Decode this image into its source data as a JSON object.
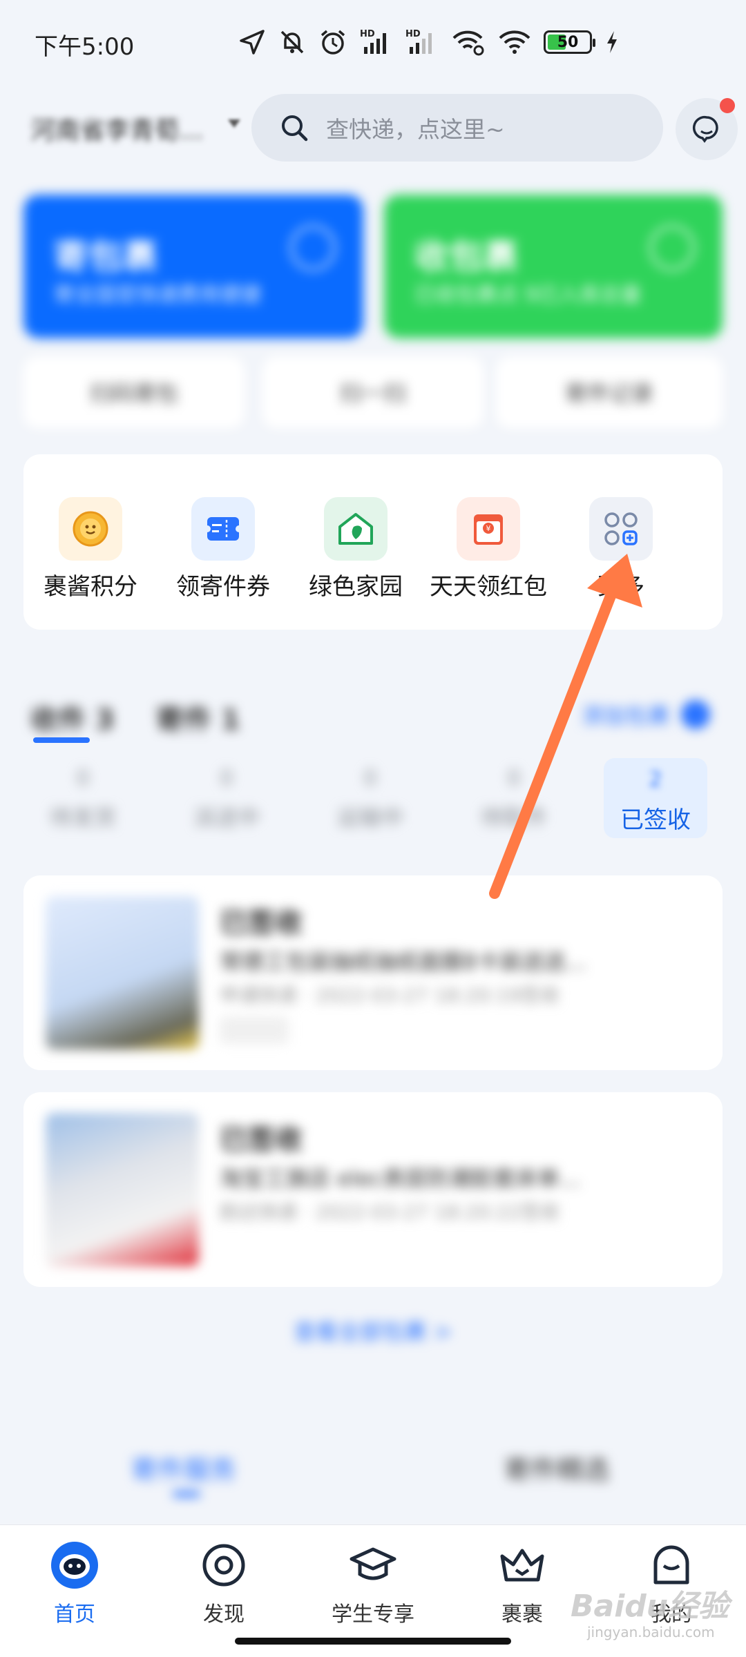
{
  "status_bar": {
    "time": "下午5:00",
    "battery": "50",
    "battery_level": 0.5,
    "icons": [
      "location-icon",
      "mute-bell-icon",
      "alarm-icon",
      "signal-hd-icon",
      "signal-hd-icon",
      "wifi-link-icon",
      "wifi-icon",
      "battery-icon",
      "charging-icon"
    ]
  },
  "header": {
    "location": "河南省李青荀...",
    "search_placeholder": "查快递，点这里~"
  },
  "banners": [
    {
      "title": "寄包裹",
      "subtitle": "寄全国官快递费用便捷",
      "color": "#0a6bff"
    },
    {
      "title": "收包裹",
      "subtitle": "已收包裹点 9已入库总量",
      "color": "#2fd35a"
    }
  ],
  "quick_pills": [
    "扫码寄包",
    "扫一扫",
    "寄件记录"
  ],
  "services": [
    {
      "label": "裹酱积分",
      "icon": "coin-icon",
      "color": "#f5a623"
    },
    {
      "label": "领寄件券",
      "icon": "coupon-icon",
      "color": "#2a73ff"
    },
    {
      "label": "绿色家园",
      "icon": "green-home-icon",
      "color": "#21a559"
    },
    {
      "label": "天天领红包",
      "icon": "red-packet-icon",
      "color": "#f05a3c"
    },
    {
      "label": "更多",
      "icon": "more-apps-icon",
      "color": "#7a8aa8"
    }
  ],
  "package_tabs": {
    "tabs": [
      "收件 3",
      "寄件 1"
    ],
    "add_label": "添加包裹",
    "statuses": [
      {
        "num": "0",
        "label": "待发货"
      },
      {
        "num": "0",
        "label": "派送中"
      },
      {
        "num": "0",
        "label": "运输中"
      },
      {
        "num": "0",
        "label": "待取件"
      },
      {
        "num": "2",
        "label": "已签收"
      }
    ]
  },
  "packages": [
    {
      "state": "已签收",
      "name": "常德工包装抽纸抽纸面膜8卡装送送...",
      "time": "申通快递 · 2022-03-27 18:20:19签收"
    },
    {
      "state": "已签收",
      "name": "淘宝工旗店 elec表层防潮胶套床单...",
      "time": "韵达快递 · 2022-03-27 18:20:22签收"
    }
  ],
  "all_packages_link": "查看全部包裹 >",
  "news_tabs": [
    "寄件服务",
    "寄件精选"
  ],
  "bottom_nav": [
    {
      "label": "首页",
      "icon": "home-mascot-icon",
      "active": true
    },
    {
      "label": "发现",
      "icon": "discover-icon",
      "active": false
    },
    {
      "label": "学生专享",
      "icon": "student-cap-icon",
      "active": false
    },
    {
      "label": "裹裹",
      "icon": "crown-icon",
      "active": false
    },
    {
      "label": "我的",
      "icon": "profile-icon",
      "active": false
    }
  ],
  "watermark": {
    "text": "Baidu经验",
    "sub": "jingyan.baidu.com"
  },
  "colors": {
    "accent": "#2a73ff",
    "annotation_arrow": "#ff7a45"
  }
}
